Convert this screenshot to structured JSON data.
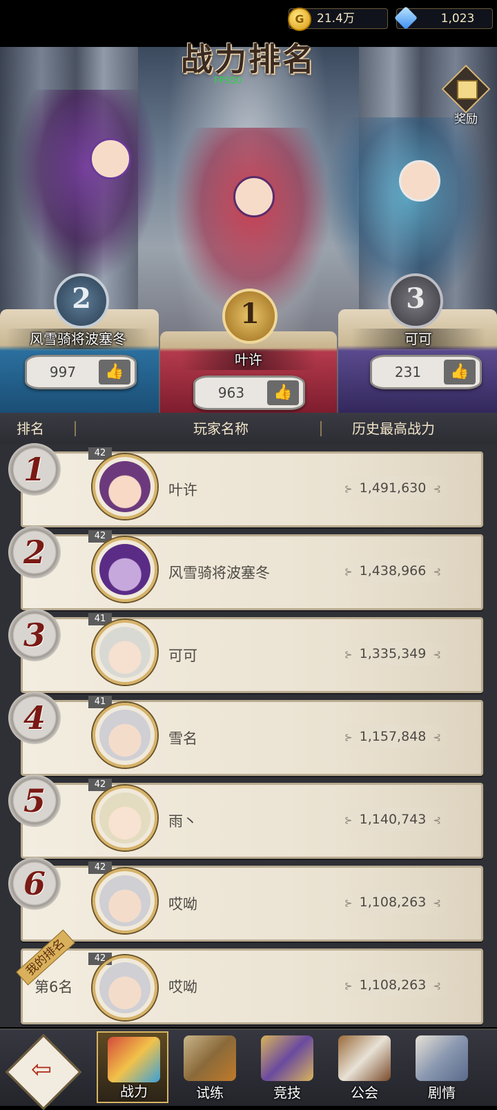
{
  "resources": {
    "gold": {
      "icon": "G",
      "value": "21.4万"
    },
    "gems": {
      "value": "1,023"
    }
  },
  "title": {
    "text": "战力排名",
    "watermark": "FPS50"
  },
  "reward": {
    "label": "奖励"
  },
  "podium": [
    {
      "rank": "1",
      "name": "叶许",
      "likes": "963"
    },
    {
      "rank": "2",
      "name": "风雪骑将波塞冬",
      "likes": "997"
    },
    {
      "rank": "3",
      "name": "可可",
      "likes": "231"
    }
  ],
  "thumb_icon": "👍",
  "table": {
    "headers": {
      "rank": "排名",
      "name": "玩家名称",
      "power": "历史最高战力"
    },
    "rows": [
      {
        "rank": "1",
        "level": "42",
        "name": "叶许",
        "power": "1,491,630"
      },
      {
        "rank": "2",
        "level": "42",
        "name": "风雪骑将波塞冬",
        "power": "1,438,966"
      },
      {
        "rank": "3",
        "level": "41",
        "name": "可可",
        "power": "1,335,349"
      },
      {
        "rank": "4",
        "level": "41",
        "name": "雪名",
        "power": "1,157,848"
      },
      {
        "rank": "5",
        "level": "42",
        "name": "雨丶",
        "power": "1,140,743"
      },
      {
        "rank": "6",
        "level": "42",
        "name": "哎呦",
        "power": "1,108,263"
      }
    ],
    "mine": {
      "tag": "我的排名",
      "rank_text": "第6名",
      "level": "42",
      "name": "哎呦",
      "power": "1,108,263"
    }
  },
  "nav": {
    "back_icon": "⇦",
    "tabs": [
      {
        "label": "战力",
        "active": true
      },
      {
        "label": "试练",
        "active": false
      },
      {
        "label": "竞技",
        "active": false
      },
      {
        "label": "公会",
        "active": false
      },
      {
        "label": "剧情",
        "active": false
      }
    ]
  },
  "colors": {
    "rank_numeral": "#7a1a14",
    "row_bg": "#f3ede0",
    "header_text": "#f1e4c8",
    "nav_bg": "#2a2b31",
    "active_tab_border": "#d7b563"
  }
}
